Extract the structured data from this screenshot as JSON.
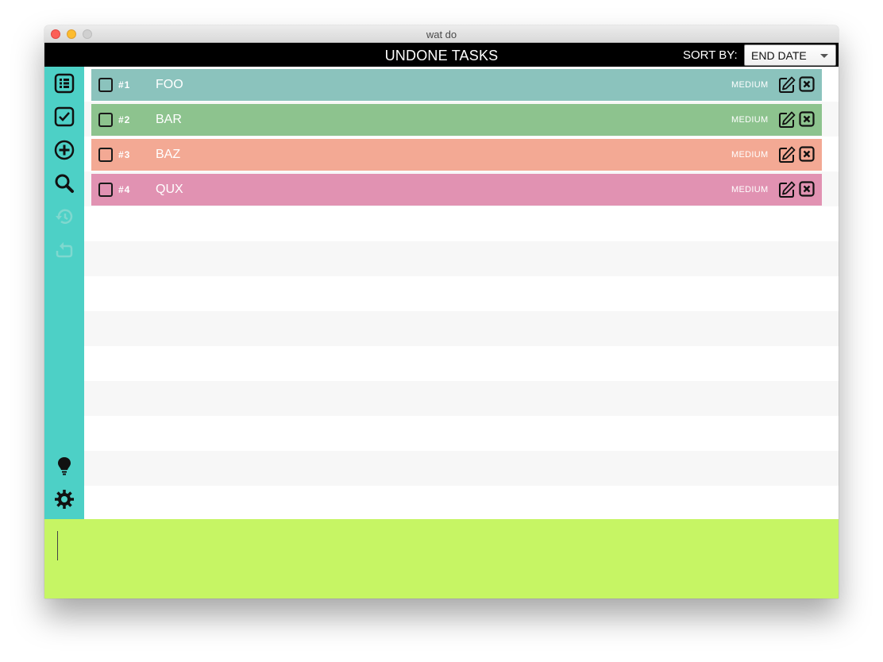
{
  "window": {
    "title": "wat do"
  },
  "header": {
    "title": "UNDONE TASKS",
    "sort_label": "SORT BY:",
    "sort_value": "END DATE"
  },
  "sidebar": {
    "items": [
      {
        "icon": "list-icon",
        "state": "active"
      },
      {
        "icon": "checkbox-icon",
        "state": "active"
      },
      {
        "icon": "add-circle-icon",
        "state": "active"
      },
      {
        "icon": "search-icon",
        "state": "active"
      },
      {
        "icon": "undo-history-icon",
        "state": "disabled"
      },
      {
        "icon": "redo-repeat-icon",
        "state": "disabled"
      },
      {
        "icon": "lightbulb-icon",
        "state": "active"
      },
      {
        "icon": "gear-icon",
        "state": "active"
      }
    ],
    "color": "#4dd0c6"
  },
  "tasks": [
    {
      "number": "#1",
      "name": "FOO",
      "priority": "MEDIUM",
      "color": "#8bc3bd",
      "done": false
    },
    {
      "number": "#2",
      "name": "BAR",
      "priority": "MEDIUM",
      "color": "#8dc38e",
      "done": false
    },
    {
      "number": "#3",
      "name": "BAZ",
      "priority": "MEDIUM",
      "color": "#f3a994",
      "done": false
    },
    {
      "number": "#4",
      "name": "QUX",
      "priority": "MEDIUM",
      "color": "#e192b2",
      "done": false
    }
  ],
  "command": {
    "value": "",
    "color": "#c6f564"
  }
}
